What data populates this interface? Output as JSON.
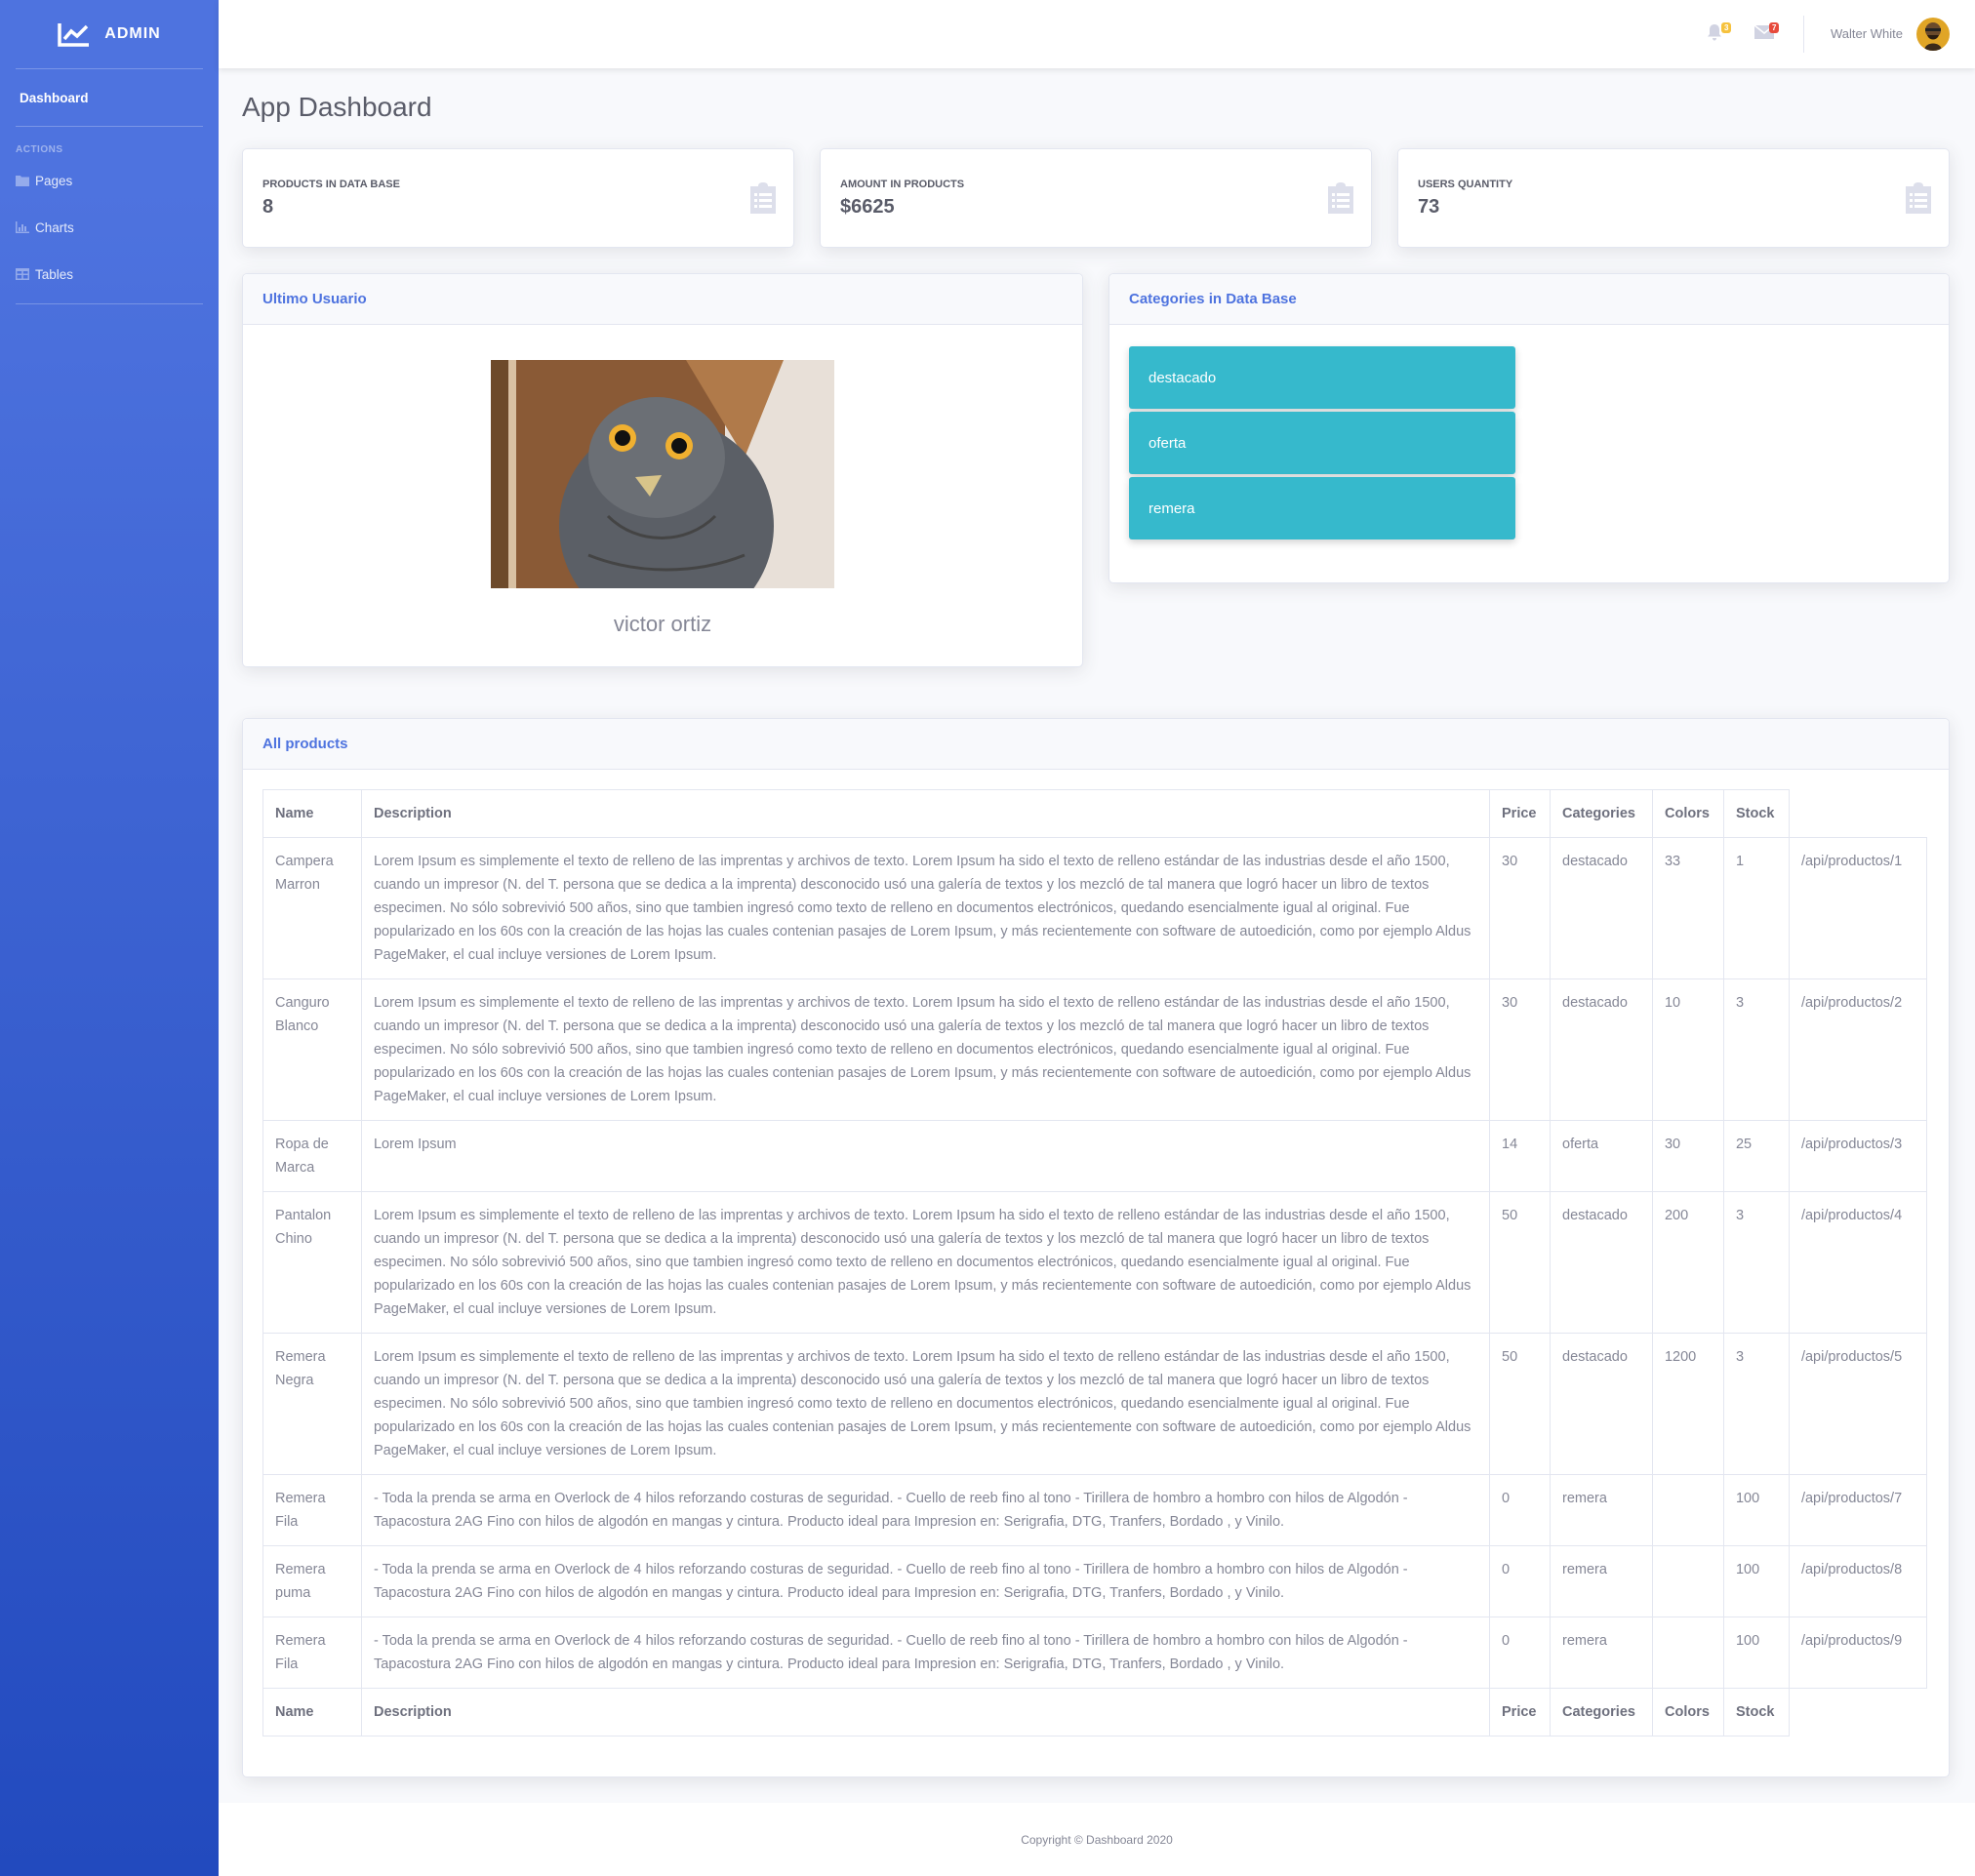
{
  "brand": {
    "name": "ADMIN",
    "icon": "chart-line-icon"
  },
  "sidebar": {
    "dashboard_label": "Dashboard",
    "heading": "ACTIONS",
    "items": [
      {
        "label": "Pages",
        "icon": "folder-icon"
      },
      {
        "label": "Charts",
        "icon": "chart-bar-icon"
      },
      {
        "label": "Tables",
        "icon": "table-icon"
      }
    ]
  },
  "topbar": {
    "alerts_count": "3",
    "messages_count": "7",
    "user_name": "Walter White"
  },
  "page": {
    "title": "App Dashboard"
  },
  "stats": [
    {
      "label": "PRODUCTS IN DATA BASE",
      "value": "8"
    },
    {
      "label": "AMOUNT IN PRODUCTS",
      "value": "$6625"
    },
    {
      "label": "USERS QUANTITY",
      "value": "73"
    }
  ],
  "last_user": {
    "title": "Ultimo Usuario",
    "name": "victor ortiz"
  },
  "categories": {
    "title": "Categories in Data Base",
    "items": [
      "destacado",
      "oferta",
      "remera"
    ]
  },
  "products": {
    "title": "All products",
    "columns": [
      "Name",
      "Description",
      "Price",
      "Categories",
      "Colors",
      "Stock"
    ],
    "rows": [
      {
        "name": "Campera Marron",
        "description": "Lorem Ipsum es simplemente el texto de relleno de las imprentas y archivos de texto. Lorem Ipsum ha sido el texto de relleno estándar de las industrias desde el año 1500, cuando un impresor (N. del T. persona que se dedica a la imprenta) desconocido usó una galería de textos y los mezcló de tal manera que logró hacer un libro de textos especimen. No sólo sobrevivió 500 años, sino que tambien ingresó como texto de relleno en documentos electrónicos, quedando esencialmente igual al original. Fue popularizado en los 60s con la creación de las hojas las cuales contenian pasajes de Lorem Ipsum, y más recientemente con software de autoedición, como por ejemplo Aldus PageMaker, el cual incluye versiones de Lorem Ipsum.",
        "price": "30",
        "category": "destacado",
        "colors": "33",
        "stock": "1",
        "link": "/api/productos/1"
      },
      {
        "name": "Canguro Blanco",
        "description": "Lorem Ipsum es simplemente el texto de relleno de las imprentas y archivos de texto. Lorem Ipsum ha sido el texto de relleno estándar de las industrias desde el año 1500, cuando un impresor (N. del T. persona que se dedica a la imprenta) desconocido usó una galería de textos y los mezcló de tal manera que logró hacer un libro de textos especimen. No sólo sobrevivió 500 años, sino que tambien ingresó como texto de relleno en documentos electrónicos, quedando esencialmente igual al original. Fue popularizado en los 60s con la creación de las hojas las cuales contenian pasajes de Lorem Ipsum, y más recientemente con software de autoedición, como por ejemplo Aldus PageMaker, el cual incluye versiones de Lorem Ipsum.",
        "price": "30",
        "category": "destacado",
        "colors": "10",
        "stock": "3",
        "link": "/api/productos/2"
      },
      {
        "name": "Ropa de Marca",
        "description": "Lorem Ipsum",
        "price": "14",
        "category": "oferta",
        "colors": "30",
        "stock": "25",
        "link": "/api/productos/3"
      },
      {
        "name": "Pantalon Chino",
        "description": "Lorem Ipsum es simplemente el texto de relleno de las imprentas y archivos de texto. Lorem Ipsum ha sido el texto de relleno estándar de las industrias desde el año 1500, cuando un impresor (N. del T. persona que se dedica a la imprenta) desconocido usó una galería de textos y los mezcló de tal manera que logró hacer un libro de textos especimen. No sólo sobrevivió 500 años, sino que tambien ingresó como texto de relleno en documentos electrónicos, quedando esencialmente igual al original. Fue popularizado en los 60s con la creación de las hojas las cuales contenian pasajes de Lorem Ipsum, y más recientemente con software de autoedición, como por ejemplo Aldus PageMaker, el cual incluye versiones de Lorem Ipsum.",
        "price": "50",
        "category": "destacado",
        "colors": "200",
        "stock": "3",
        "link": "/api/productos/4"
      },
      {
        "name": "Remera Negra",
        "description": "Lorem Ipsum es simplemente el texto de relleno de las imprentas y archivos de texto. Lorem Ipsum ha sido el texto de relleno estándar de las industrias desde el año 1500, cuando un impresor (N. del T. persona que se dedica a la imprenta) desconocido usó una galería de textos y los mezcló de tal manera que logró hacer un libro de textos especimen. No sólo sobrevivió 500 años, sino que tambien ingresó como texto de relleno en documentos electrónicos, quedando esencialmente igual al original. Fue popularizado en los 60s con la creación de las hojas las cuales contenian pasajes de Lorem Ipsum, y más recientemente con software de autoedición, como por ejemplo Aldus PageMaker, el cual incluye versiones de Lorem Ipsum.",
        "price": "50",
        "category": "destacado",
        "colors": "1200",
        "stock": "3",
        "link": "/api/productos/5"
      },
      {
        "name": "Remera Fila",
        "description": "- Toda la prenda se arma en Overlock de 4 hilos reforzando costuras de seguridad. - Cuello de reeb fino al tono - Tirillera de hombro a hombro con hilos de Algodón - Tapacostura 2AG Fino con hilos de algodón en mangas y cintura. Producto ideal para Impresion en: Serigrafia, DTG, Tranfers, Bordado , y Vinilo.",
        "price": "0",
        "category": "remera",
        "colors": "",
        "stock": "100",
        "link": "/api/productos/7"
      },
      {
        "name": "Remera puma",
        "description": "- Toda la prenda se arma en Overlock de 4 hilos reforzando costuras de seguridad. - Cuello de reeb fino al tono - Tirillera de hombro a hombro con hilos de Algodón - Tapacostura 2AG Fino con hilos de algodón en mangas y cintura. Producto ideal para Impresion en: Serigrafia, DTG, Tranfers, Bordado , y Vinilo.",
        "price": "0",
        "category": "remera",
        "colors": "",
        "stock": "100",
        "link": "/api/productos/8"
      },
      {
        "name": "Remera Fila",
        "description": "- Toda la prenda se arma en Overlock de 4 hilos reforzando costuras de seguridad. - Cuello de reeb fino al tono - Tirillera de hombro a hombro con hilos de Algodón - Tapacostura 2AG Fino con hilos de algodón en mangas y cintura. Producto ideal para Impresion en: Serigrafia, DTG, Tranfers, Bordado , y Vinilo.",
        "price": "0",
        "category": "remera",
        "colors": "",
        "stock": "100",
        "link": "/api/productos/9"
      }
    ]
  },
  "footer": {
    "text": "Copyright © Dashboard 2020"
  }
}
